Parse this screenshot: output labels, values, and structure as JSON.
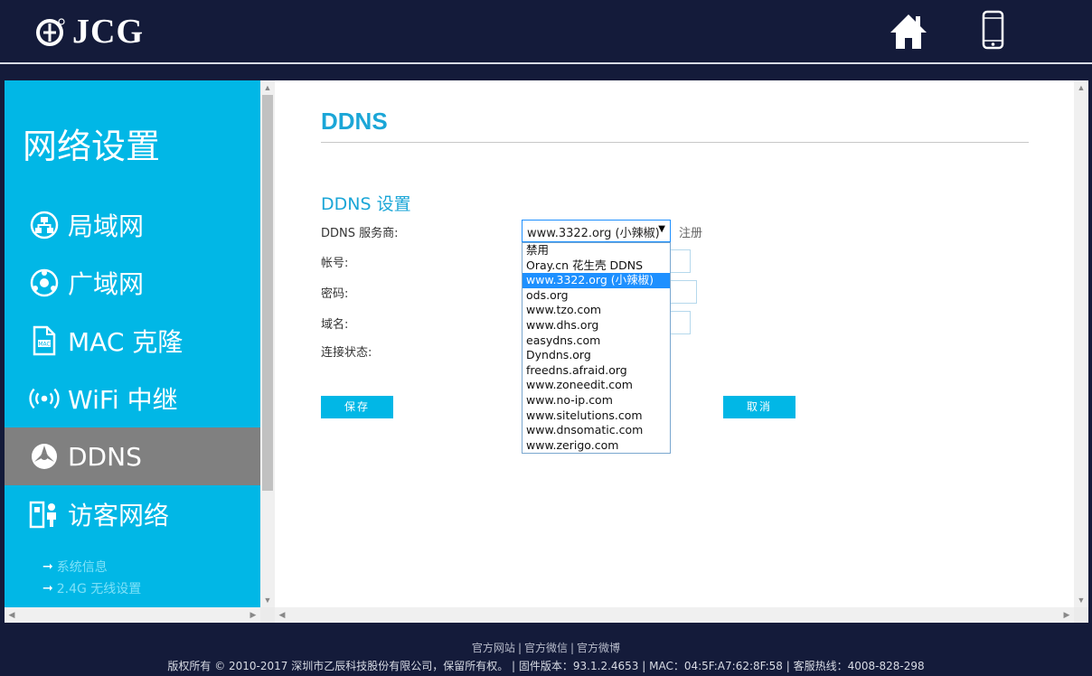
{
  "brand": {
    "name": "JCG"
  },
  "sidebar": {
    "title": "网络设置",
    "items": [
      {
        "label": "局域网",
        "icon": "lan-icon"
      },
      {
        "label": "广域网",
        "icon": "wan-icon"
      },
      {
        "label": "MAC 克隆",
        "icon": "mac-clone-icon"
      },
      {
        "label": "WiFi 中继",
        "icon": "wifi-repeater-icon"
      },
      {
        "label": "DDNS",
        "icon": "ddns-icon",
        "active": true
      },
      {
        "label": "访客网络",
        "icon": "guest-network-icon"
      }
    ],
    "sub_items": [
      {
        "label": "系统信息"
      },
      {
        "label": "2.4G 无线设置"
      }
    ]
  },
  "main": {
    "page_title": "DDNS",
    "section_title": "DDNS 设置",
    "labels": {
      "provider": "DDNS 服务商:",
      "account": "帐号:",
      "password": "密码:",
      "domain": "域名:",
      "status": "连接状态:"
    },
    "provider_select": {
      "value": "www.3322.org (小辣椒)",
      "options": [
        "禁用",
        "Oray.cn 花生壳 DDNS",
        "www.3322.org (小辣椒)",
        "ods.org",
        "www.tzo.com",
        "www.dhs.org",
        "easydns.com",
        "Dyndns.org",
        "freedns.afraid.org",
        "www.zoneedit.com",
        "www.no-ip.com",
        "www.sitelutions.com",
        "www.dnsomatic.com",
        "www.zerigo.com"
      ],
      "selected_index": 2
    },
    "register_link": "注册",
    "save_button": "保存",
    "cancel_button": "取消"
  },
  "footer": {
    "links": [
      "官方网站",
      "官方微信",
      "官方微博"
    ],
    "copyright": "版权所有 © 2010-2017 深圳市乙辰科技股份有限公司，保留所有权。 | 固件版本：93.1.2.4653 | MAC：04:5F:A7:62:8F:58 | 客服热线：4008-828-298"
  },
  "colors": {
    "header_bg": "#141b3a",
    "sidebar_bg": "#01b7e6",
    "active_bg": "#808080",
    "accent": "#1ba6d7"
  }
}
